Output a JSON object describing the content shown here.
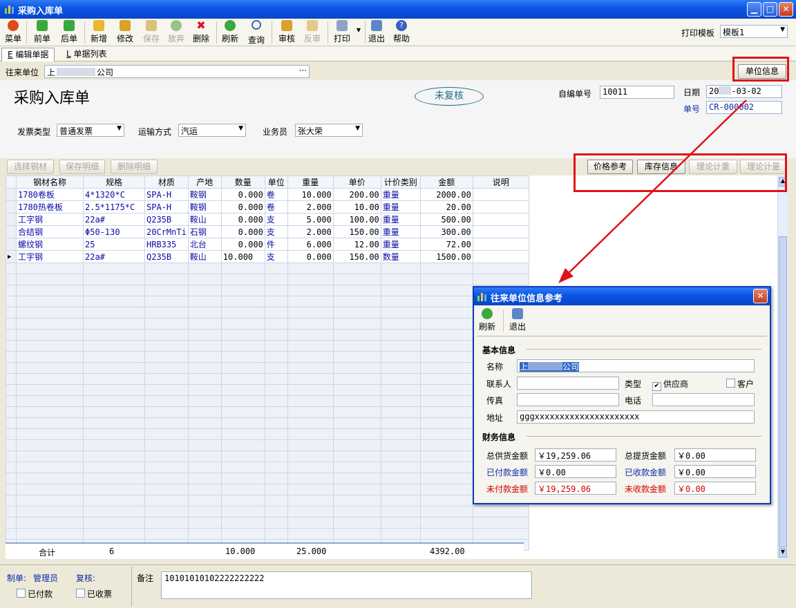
{
  "window": {
    "title": "采购入库单"
  },
  "toolbar": {
    "items": [
      {
        "label": "菜单"
      },
      {
        "label": "前单"
      },
      {
        "label": "后单"
      },
      {
        "label": "新增"
      },
      {
        "label": "修改"
      },
      {
        "label": "保存"
      },
      {
        "label": "放弃"
      },
      {
        "label": "删除"
      },
      {
        "label": "刷新"
      },
      {
        "label": "查询"
      },
      {
        "label": "审核"
      },
      {
        "label": "反审"
      },
      {
        "label": "打印"
      },
      {
        "label": "退出"
      },
      {
        "label": "帮助"
      }
    ],
    "print_template_label": "打印模板",
    "print_template_value": "模板1"
  },
  "tabs": [
    {
      "key": "E",
      "label": "编辑单据"
    },
    {
      "key": "L",
      "label": "单据列表"
    }
  ],
  "form": {
    "partner_label": "往来单位",
    "partner_value": "上",
    "partner_value_tail": "公司",
    "partner_more": "···",
    "partner_info_button": "单位信息",
    "doc_title": "采购入库单",
    "status_badge": "未复核",
    "self_no_label": "自编单号",
    "self_no_value": "10011",
    "date_label": "日期",
    "date_value_head": "20",
    "date_value_tail": "-03-02",
    "doc_no_label": "单号",
    "doc_no_value": "CR-000002",
    "invoice_type_label": "发票类型",
    "invoice_type_value": "普通发票",
    "transport_label": "运输方式",
    "transport_value": "汽运",
    "salesman_label": "业务员",
    "salesman_value": "张大荣"
  },
  "detail_buttons": {
    "select_steel": "选择钢材",
    "save_detail": "保存明细",
    "delete_detail": "删除明细",
    "price_ref": "价格参考",
    "stock_info": "库存信息",
    "theory_weight": "理论计重",
    "theory_calc": "理论计量"
  },
  "grid": {
    "columns": [
      "钢材名称",
      "规格",
      "材质",
      "产地",
      "数量",
      "单位",
      "重量",
      "单价",
      "计价类别",
      "金额",
      "说明"
    ],
    "rows": [
      [
        "1780卷板",
        "4*1320*C",
        "SPA-H",
        "鞍钢",
        "0.000",
        "卷",
        "10.000",
        "200.00",
        "重量",
        "2000.00",
        ""
      ],
      [
        "1780热卷板",
        "2.5*1175*C",
        "SPA-H",
        "鞍钢",
        "0.000",
        "卷",
        "2.000",
        "10.00",
        "重量",
        "20.00",
        ""
      ],
      [
        "工字钢",
        "22a#",
        "Q235B",
        "鞍山",
        "0.000",
        "支",
        "5.000",
        "100.00",
        "重量",
        "500.00",
        ""
      ],
      [
        "合结钢",
        "Φ50-130",
        "20CrMnTi",
        "石钢",
        "0.000",
        "支",
        "2.000",
        "150.00",
        "重量",
        "300.00",
        ""
      ],
      [
        "螺纹钢",
        "25",
        "HRB335",
        "北台",
        "0.000",
        "件",
        "6.000",
        "12.00",
        "重量",
        "72.00",
        ""
      ],
      [
        "工字钢",
        "22a#",
        "Q235B",
        "鞍山",
        "10.000",
        "支",
        "0.000",
        "150.00",
        "数量",
        "1500.00",
        ""
      ]
    ],
    "totals": {
      "label": "合计",
      "count": "6",
      "qty": "10.000",
      "weight": "25.000",
      "amount": "4392.00"
    }
  },
  "footer": {
    "maker_label": "制单:",
    "maker_value": "管理员",
    "reviewer_label": "复核:",
    "paid_label": "已付款",
    "invoiced_label": "已收票",
    "remark_label": "备注",
    "remark_value": "10101010102222222222"
  },
  "dialog": {
    "title": "往来单位信息参考",
    "refresh": "刷新",
    "exit": "退出",
    "basic_section": "基本信息",
    "name_label": "名称",
    "name_value_head": "上",
    "name_value_tail": "公司",
    "contact_label": "联系人",
    "contact_value": "",
    "type_label": "类型",
    "supplier_label": "供应商",
    "supplier_checked": true,
    "customer_label": "客户",
    "fax_label": "传真",
    "fax_value": "",
    "phone_label": "电话",
    "phone_value": "",
    "address_label": "地址",
    "address_value": "gggxxxxxxxxxxxxxxxxxxxxx",
    "finance_section": "财务信息",
    "total_supply_label": "总供货金额",
    "total_supply_value": "￥19,259.06",
    "total_pickup_label": "总提货金额",
    "total_pickup_value": "￥0.00",
    "paid_label": "已付款金额",
    "paid_value": "￥0.00",
    "received_label": "已收款金额",
    "received_value": "￥0.00",
    "unpaid_label": "未付款金额",
    "unpaid_value": "￥19,259.06",
    "unreceived_label": "未收款金额",
    "unreceived_value": "￥0.00"
  }
}
